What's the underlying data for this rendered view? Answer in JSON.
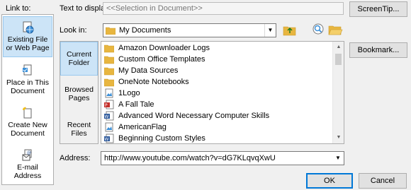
{
  "link_to_label": "Link to:",
  "sidebar": {
    "items": [
      {
        "label_line1": "Existing File",
        "label_line2": "or Web Page",
        "icon": "web-page-globe-icon",
        "selected": true
      },
      {
        "label_line1": "Place in This",
        "label_line2": "Document",
        "icon": "document-bookmark-icon",
        "selected": false
      },
      {
        "label_line1": "Create New",
        "label_line2": "Document",
        "icon": "new-document-icon",
        "selected": false
      },
      {
        "label_line1": "E-mail",
        "label_line2": "Address",
        "icon": "email-icon",
        "selected": false
      }
    ]
  },
  "text_to_display": {
    "label": "Text to display:",
    "value": "<<Selection in Document>>"
  },
  "look_in": {
    "label": "Look in:",
    "value": "My Documents",
    "icon": "folder-icon"
  },
  "tabs": [
    {
      "line1": "Current",
      "line2": "Folder",
      "selected": true
    },
    {
      "line1": "Browsed",
      "line2": "Pages",
      "selected": false
    },
    {
      "line1": "Recent",
      "line2": "Files",
      "selected": false
    }
  ],
  "files": [
    {
      "name": "Amazon Downloader Logs",
      "icon": "folder-icon"
    },
    {
      "name": "Custom Office Templates",
      "icon": "folder-icon"
    },
    {
      "name": "My Data Sources",
      "icon": "folder-icon"
    },
    {
      "name": "OneNote Notebooks",
      "icon": "folder-icon"
    },
    {
      "name": "1Logo",
      "icon": "image-file-icon"
    },
    {
      "name": "A Fall Tale",
      "icon": "pdf-file-icon"
    },
    {
      "name": "Advanced Word Necessary Computer Skills",
      "icon": "word-file-icon"
    },
    {
      "name": "AmericanFlag",
      "icon": "image-file-icon"
    },
    {
      "name": "Beginning Custom Styles",
      "icon": "word-file-icon"
    }
  ],
  "address": {
    "label": "Address:",
    "value": "http://www.youtube.com/watch?v=dG7KLqvqXwU"
  },
  "buttons": {
    "screentip": "ScreenTip...",
    "bookmark": "Bookmark...",
    "ok": "OK",
    "cancel": "Cancel"
  },
  "colors": {
    "selected_bg": "#cce4f7",
    "folder_yellow": "#e8b640",
    "word_blue": "#2b579a",
    "pdf_red": "#c4302b"
  }
}
